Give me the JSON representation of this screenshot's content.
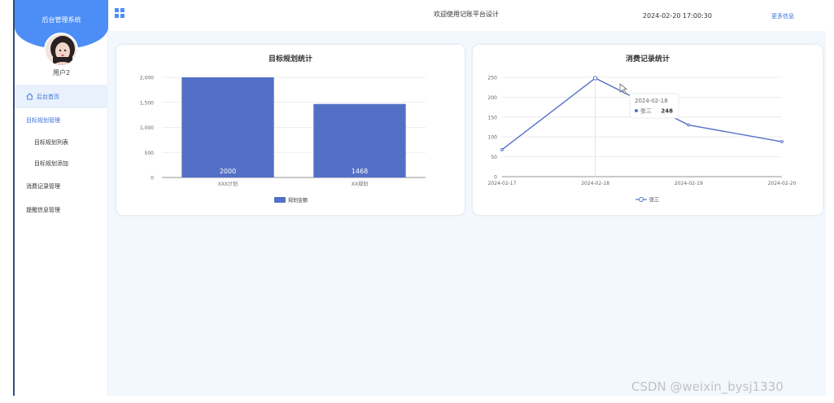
{
  "sidebar": {
    "system_title": "后台管理系统",
    "username": "用户2",
    "items": [
      {
        "label": "后台首页",
        "active": true
      },
      {
        "label": "目标规划管理"
      },
      {
        "label": "目标规划列表"
      },
      {
        "label": "目标规划添加"
      },
      {
        "label": "消费记录管理"
      },
      {
        "label": "提醒信息管理"
      }
    ]
  },
  "header": {
    "welcome": "欢迎使用记账平台设计",
    "datetime": "2024-02-20 17:00:30",
    "more_info": "更多信息"
  },
  "colors": {
    "accent": "#4d8df6",
    "bar": "#5470c6",
    "background": "#f2f8fe"
  },
  "cards": {
    "bar_title": "目标规划统计",
    "line_title": "消费记录统计"
  },
  "chart_data": [
    {
      "type": "bar",
      "title": "目标规划统计",
      "categories": [
        "XXX计划",
        "XX规划"
      ],
      "series": [
        {
          "name": "规划金额",
          "values": [
            2000,
            1468
          ]
        }
      ],
      "yticks": [
        "0",
        "500",
        "1,000",
        "1,500",
        "2,000"
      ],
      "ylim": [
        0,
        2000
      ],
      "legend": "bottom"
    },
    {
      "type": "line",
      "title": "消费记录统计",
      "categories": [
        "2024-02-17",
        "2024-02-18",
        "2024-02-19",
        "2024-02-20"
      ],
      "series": [
        {
          "name": "张三",
          "values": [
            68,
            248,
            130,
            88
          ]
        }
      ],
      "yticks": [
        "0",
        "50",
        "100",
        "150",
        "200",
        "250"
      ],
      "ylim": [
        0,
        250
      ],
      "legend": "bottom",
      "tooltip": {
        "date": "2024-02-18",
        "name": "张三",
        "value": "248"
      }
    }
  ],
  "watermark": "CSDN @weixin_bysj1330"
}
